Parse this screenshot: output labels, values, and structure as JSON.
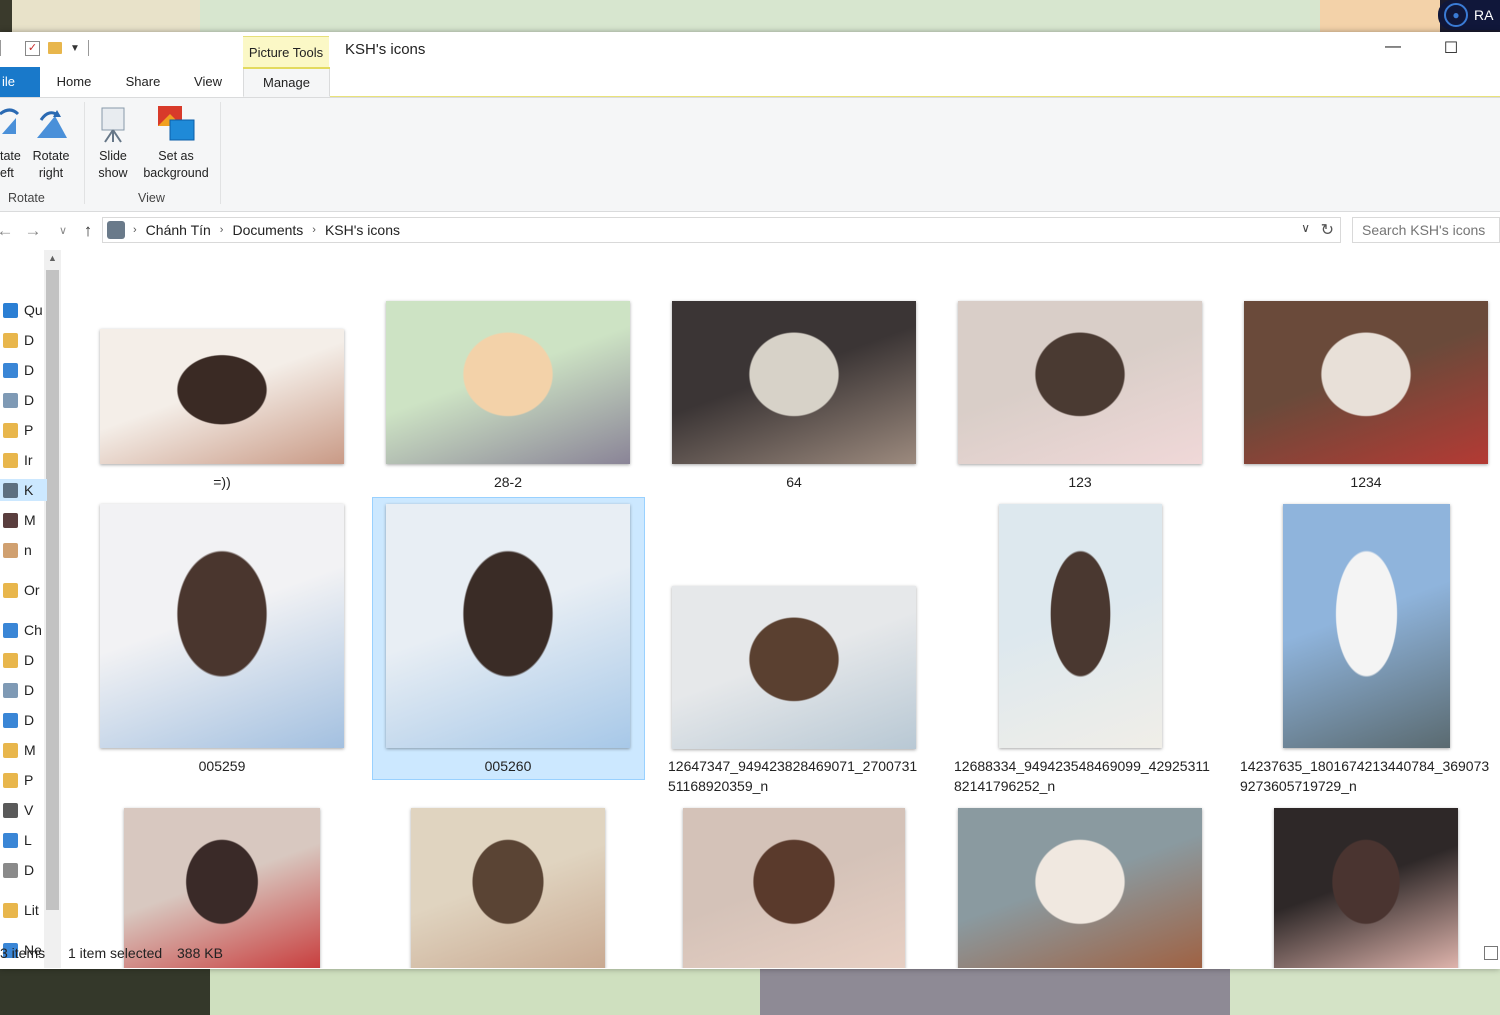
{
  "window": {
    "title": "KSH's icons",
    "context_tab": "Picture Tools",
    "minimize_glyph": "—",
    "maximize_glyph": "☐"
  },
  "desktop": {
    "user_label": "RA"
  },
  "ribbon": {
    "tabs": [
      {
        "label": "ile"
      },
      {
        "label": "Home"
      },
      {
        "label": "Share"
      },
      {
        "label": "View"
      },
      {
        "label": "Manage"
      }
    ],
    "groups": {
      "rotate": {
        "label": "Rotate",
        "rotate_left": "tate\neft",
        "rotate_right": "Rotate\nright"
      },
      "view": {
        "label": "View",
        "slide_show": "Slide\nshow",
        "set_background": "Set as\nbackground"
      }
    }
  },
  "address": {
    "crumbs": [
      "Chánh Tín",
      "Documents",
      "KSH's icons"
    ]
  },
  "search": {
    "placeholder": "Search KSH's icons"
  },
  "navpane": {
    "items": [
      {
        "label": "Qu",
        "icon": "star-icon",
        "color": "#2b7fd4"
      },
      {
        "label": "D",
        "icon": "folder-icon",
        "color": "#e8b64c"
      },
      {
        "label": "D",
        "icon": "download-folder-icon",
        "color": "#3a86d6"
      },
      {
        "label": "D",
        "icon": "document-folder-icon",
        "color": "#7f9ab5"
      },
      {
        "label": "P",
        "icon": "pictures-folder-icon",
        "color": "#e8b64c"
      },
      {
        "label": "Ir",
        "icon": "folder-icon",
        "color": "#e8b64c"
      },
      {
        "label": "K",
        "icon": "custom-folder-icon",
        "color": "#5d6f80"
      },
      {
        "label": "M",
        "icon": "custom-folder-icon",
        "color": "#5a3e3e"
      },
      {
        "label": "n",
        "icon": "custom-folder-icon",
        "color": "#d0a070"
      },
      {
        "label": "Or",
        "icon": "onedrive-folder-icon",
        "color": "#e8b64c"
      },
      {
        "label": "Ch",
        "icon": "pc-icon",
        "color": "#3a86d6"
      },
      {
        "label": "D",
        "icon": "folder-icon",
        "color": "#e8b64c"
      },
      {
        "label": "D",
        "icon": "document-folder-icon",
        "color": "#7f9ab5"
      },
      {
        "label": "D",
        "icon": "download-folder-icon",
        "color": "#3a86d6"
      },
      {
        "label": "M",
        "icon": "music-folder-icon",
        "color": "#e8b64c"
      },
      {
        "label": "P",
        "icon": "pictures-folder-icon",
        "color": "#e8b64c"
      },
      {
        "label": "V",
        "icon": "videos-folder-icon",
        "color": "#5a5a5a"
      },
      {
        "label": "L",
        "icon": "drive-icon",
        "color": "#3a86d6"
      },
      {
        "label": "D",
        "icon": "drive-icon",
        "color": "#8a8a8a"
      },
      {
        "label": "Lit",
        "icon": "libraries-icon",
        "color": "#e8b64c"
      },
      {
        "label": "Ne",
        "icon": "network-icon",
        "color": "#3a86d6"
      }
    ]
  },
  "files": [
    {
      "name": "=))",
      "colors": [
        "#f4eee8",
        "#c99a86",
        "#3a2a24"
      ]
    },
    {
      "name": "28-2",
      "colors": [
        "#cde3c4",
        "#8a8497",
        "#f3d2a9"
      ]
    },
    {
      "name": "64",
      "colors": [
        "#3b3535",
        "#9c8a7e",
        "#d7d2c8"
      ]
    },
    {
      "name": "123",
      "colors": [
        "#d9cec8",
        "#f0d8d8",
        "#4a3a32"
      ]
    },
    {
      "name": "1234",
      "colors": [
        "#6a4a3a",
        "#b43a34",
        "#e8e0d8"
      ]
    },
    {
      "name": "005259",
      "colors": [
        "#f2f2f4",
        "#a3c0e0",
        "#4a362e"
      ]
    },
    {
      "name": "005260",
      "colors": [
        "#e8eef4",
        "#a7c8e8",
        "#3a2c26"
      ]
    },
    {
      "name": "12647347_949423828469071_270073151168920359_n",
      "colors": [
        "#e6e8ea",
        "#b8c8d4",
        "#5a4030"
      ]
    },
    {
      "name": "12688334_949423548469099_4292531182141796252_n",
      "colors": [
        "#dde8ee",
        "#f0eee8",
        "#4a3830"
      ]
    },
    {
      "name": "14237635_1801674213440784_3690739273605719729_n",
      "colors": [
        "#8fb4dc",
        "#5a6a70",
        "#f4f4f4"
      ]
    },
    {
      "name": "",
      "colors": [
        "#d8c8c0",
        "#c83a3a",
        "#3a2a28"
      ]
    },
    {
      "name": "",
      "colors": [
        "#e0d4c0",
        "#c8a890",
        "#5a4434"
      ]
    },
    {
      "name": "",
      "colors": [
        "#d4c2b8",
        "#e8d0c4",
        "#5a3a2c"
      ]
    },
    {
      "name": "",
      "colors": [
        "#8a9aa0",
        "#a06040",
        "#f0e8e0"
      ]
    },
    {
      "name": "",
      "colors": [
        "#2e2828",
        "#e4b8b0",
        "#4a3430"
      ]
    }
  ],
  "status": {
    "items_count": "3 items",
    "selection": "1 item selected",
    "size": "388 KB"
  }
}
